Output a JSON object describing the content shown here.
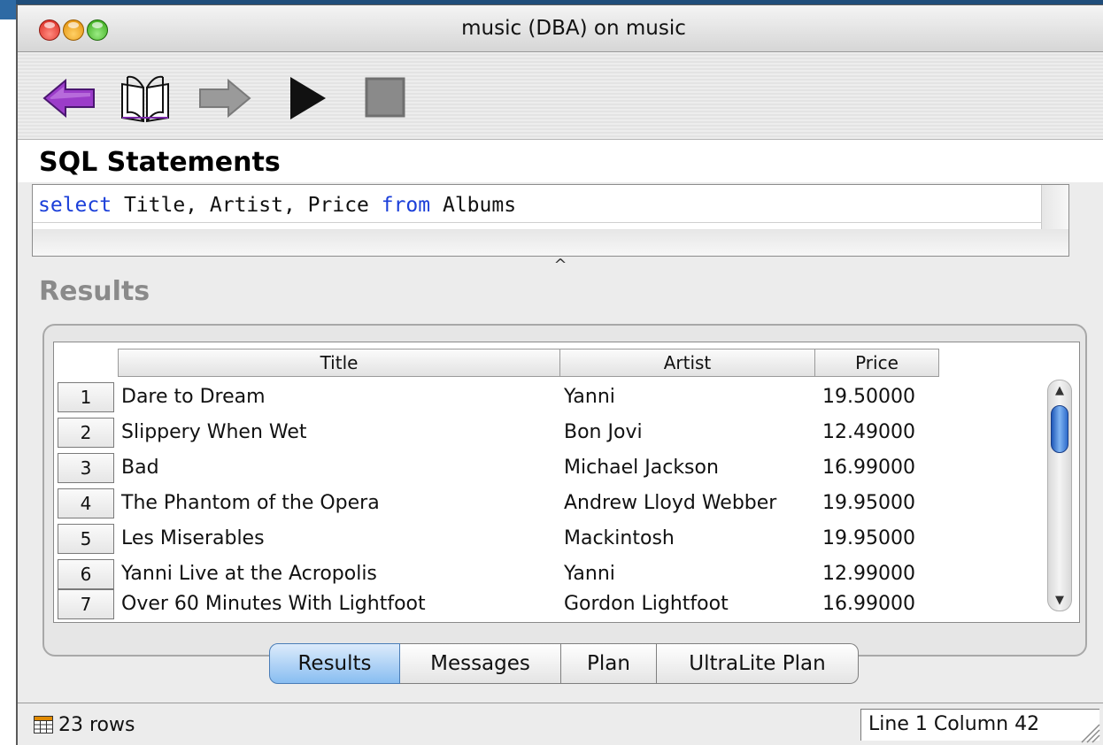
{
  "window": {
    "title": "music (DBA) on music"
  },
  "toolbar": {
    "back_icon": "back-arrow-icon",
    "book_icon": "open-book-icon",
    "forward_icon": "forward-arrow-icon",
    "run_icon": "play-icon",
    "stop_icon": "stop-icon"
  },
  "sql": {
    "section_title": "SQL Statements",
    "statement": {
      "kw_select": "select",
      "part1": " Title, Artist, Price ",
      "kw_from": "from",
      "part2": " Albums"
    }
  },
  "results": {
    "section_title": "Results",
    "columns": [
      "Title",
      "Artist",
      "Price"
    ],
    "rows": [
      {
        "num": "1",
        "title": "Dare to Dream",
        "artist": "Yanni",
        "price": "19.50000"
      },
      {
        "num": "2",
        "title": "Slippery When Wet",
        "artist": "Bon Jovi",
        "price": "12.49000"
      },
      {
        "num": "3",
        "title": "Bad",
        "artist": "Michael Jackson",
        "price": "16.99000"
      },
      {
        "num": "4",
        "title": "The Phantom of the Opera",
        "artist": "Andrew Lloyd Webber",
        "price": "19.95000"
      },
      {
        "num": "5",
        "title": "Les Miserables",
        "artist": "Mackintosh",
        "price": "19.95000"
      },
      {
        "num": "6",
        "title": "Yanni Live at the Acropolis",
        "artist": "Yanni",
        "price": "12.99000"
      },
      {
        "num": "7",
        "title": "Over 60 Minutes With Lightfoot",
        "artist": "Gordon Lightfoot",
        "price": "16.99000"
      }
    ]
  },
  "tabs": [
    "Results",
    "Messages",
    "Plan",
    "UltraLite Plan"
  ],
  "status": {
    "rows_text": "23 rows",
    "position_text": "Line 1  Column 42"
  },
  "colors": {
    "keyword": "#1b3fd9",
    "back_arrow": "#9b3cc9",
    "selected_tab": "#88bdf1"
  }
}
